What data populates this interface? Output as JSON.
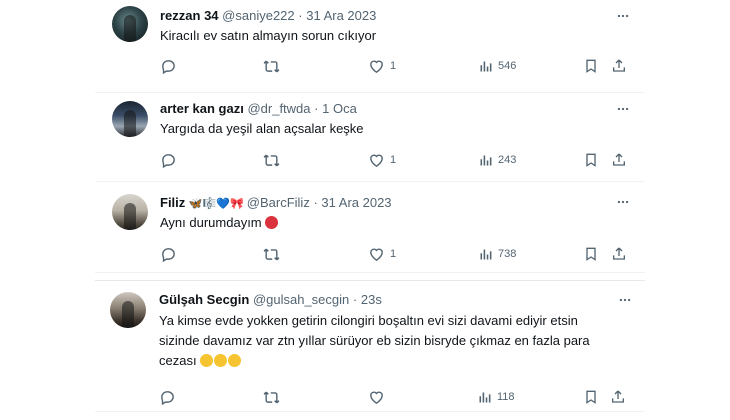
{
  "tweets": [
    {
      "name": "rezzan 34",
      "handle": "@saniye222",
      "separator": "·",
      "date": "31 Ara 2023",
      "text": "Kiracılı ev satın almayın sorun cıkıyor",
      "likes": "1",
      "views": "546"
    },
    {
      "name": "arter kan gazı",
      "handle": "@dr_ftwda",
      "separator": "·",
      "date": "1 Oca",
      "text": "Yargıda da yeşil alan açsalar keşke",
      "likes": "1",
      "views": "243"
    },
    {
      "name": "Filiz",
      "name_emoji": [
        "butterfly",
        "music-score",
        "blue-heart",
        "red-ribbon"
      ],
      "handle": "@BarcFiliz",
      "separator": "·",
      "date": "31 Ara 2023",
      "text": "Aynı durumdayım",
      "text_emoji": "angry-red-face",
      "likes": "1",
      "views": "738"
    },
    {
      "name": "Gülşah Secgin",
      "handle": "@gulsah_secgin",
      "separator": "·",
      "date": "23s",
      "text_line1": "Ya kimse evde yokken getirin cilongiri boşaltın evi sizi davami ediyir etsin",
      "text_line2": "sizinde davamız var ztn yıllar sürüyor eb sizin bisryde çıkmaz en fazla para",
      "text_line3": "cezası",
      "text_emoji": [
        "grinning-sweat-face",
        "grinning-sweat-face",
        "grinning-sweat-face"
      ],
      "likes": "",
      "views": "118"
    }
  ],
  "icons": {
    "reply": "reply-icon",
    "retweet": "retweet-icon",
    "like": "heart-icon",
    "views": "views-icon",
    "bookmark": "bookmark-icon",
    "share": "share-icon",
    "more": "more-icon"
  },
  "colors": {
    "text": "#0f1419",
    "muted": "#536471",
    "divider": "#eff3f4"
  }
}
